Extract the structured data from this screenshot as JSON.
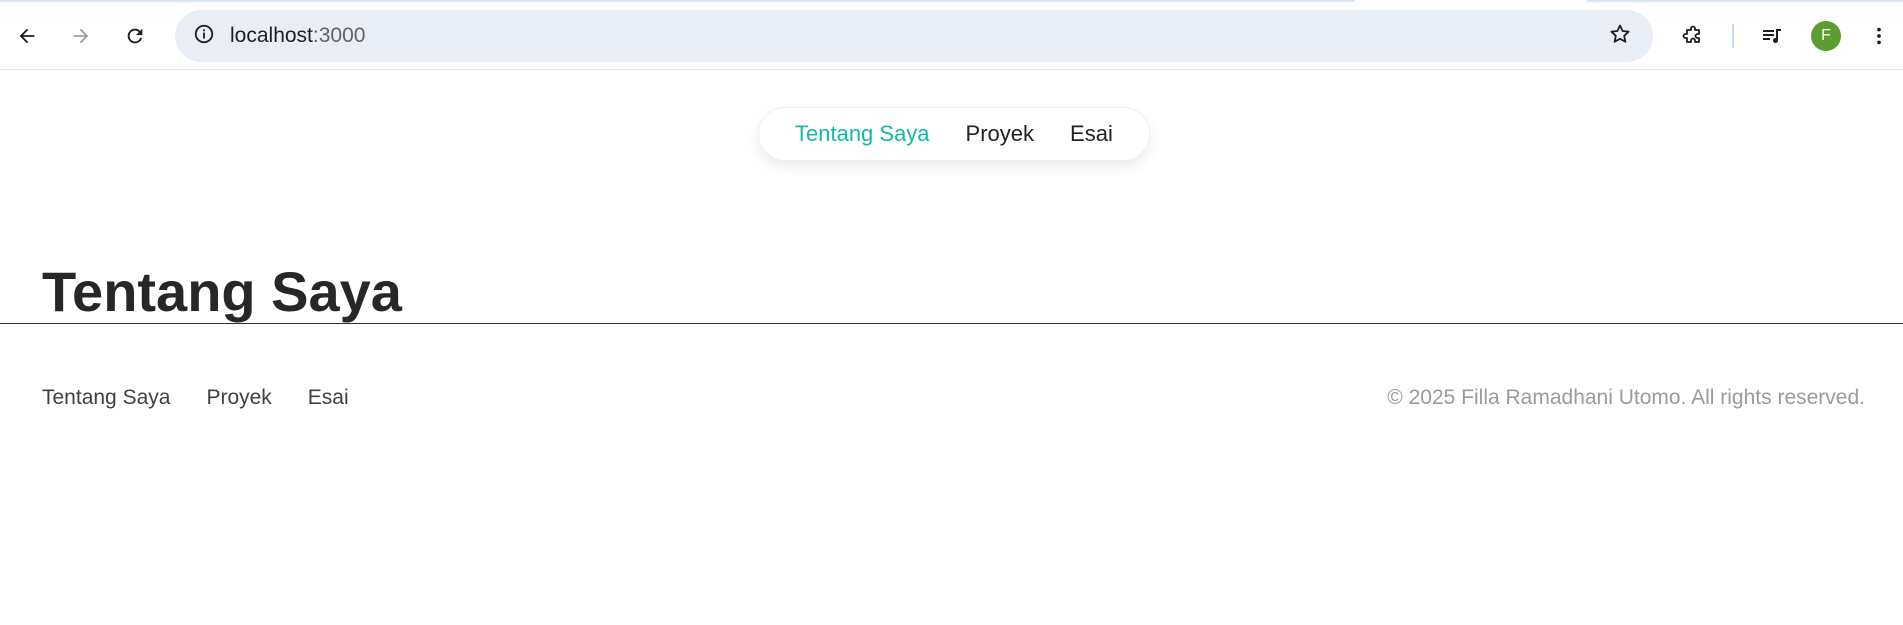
{
  "browser": {
    "url_host": "localhost",
    "url_port": ":3000",
    "avatar_letter": "F",
    "avatar_color": "#5a9e2f",
    "icons": [
      "back-arrow-icon",
      "forward-arrow-icon",
      "reload-icon",
      "site-info-icon",
      "bookmark-star-icon",
      "extensions-puzzle-icon",
      "media-playlist-icon",
      "more-vert-icon"
    ]
  },
  "nav": {
    "items": [
      {
        "label": "Tentang Saya",
        "active": true
      },
      {
        "label": "Proyek",
        "active": false
      },
      {
        "label": "Esai",
        "active": false
      }
    ],
    "accent_color": "#14b8a6"
  },
  "main": {
    "title": "Tentang Saya"
  },
  "footer": {
    "links": [
      "Tentang Saya",
      "Proyek",
      "Esai"
    ],
    "copyright": "© 2025 Filla Ramadhani Utomo. All rights reserved."
  }
}
